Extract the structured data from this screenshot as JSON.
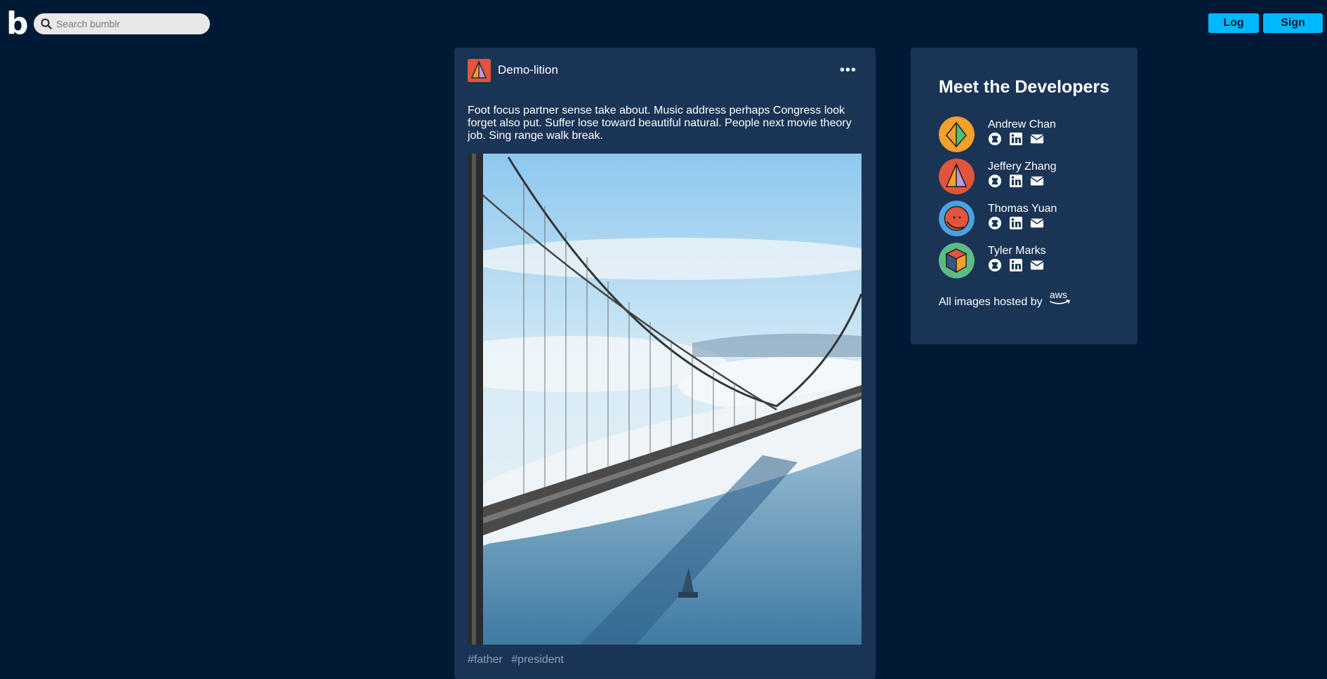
{
  "header": {
    "logo_text": "b",
    "search_placeholder": "Search bumblr",
    "login_label": "Log In",
    "signup_label": "Sign Up"
  },
  "post": {
    "author": "Demo-lition",
    "menu_icon": "ellipsis-icon",
    "text": "Foot focus partner sense take about. Music address perhaps Congress look forget also put. Suffer lose toward beautiful natural. People next movie theory job. Sing range walk break.",
    "tags": [
      "#father",
      "#president"
    ]
  },
  "sidebar": {
    "title": "Meet the Developers",
    "developers": [
      {
        "name": "Andrew Chan",
        "avatar_color": "#f4a12a"
      },
      {
        "name": "Jeffery Zhang",
        "avatar_color": "#e0553b"
      },
      {
        "name": "Thomas Yuan",
        "avatar_color": "#4aa3df"
      },
      {
        "name": "Tyler Marks",
        "avatar_color": "#5dbb86"
      }
    ],
    "hosted_text": "All images hosted by",
    "hosted_logo": "aws"
  },
  "colors": {
    "background": "#001935",
    "card": "#1a3456",
    "accent": "#00b8ff"
  }
}
